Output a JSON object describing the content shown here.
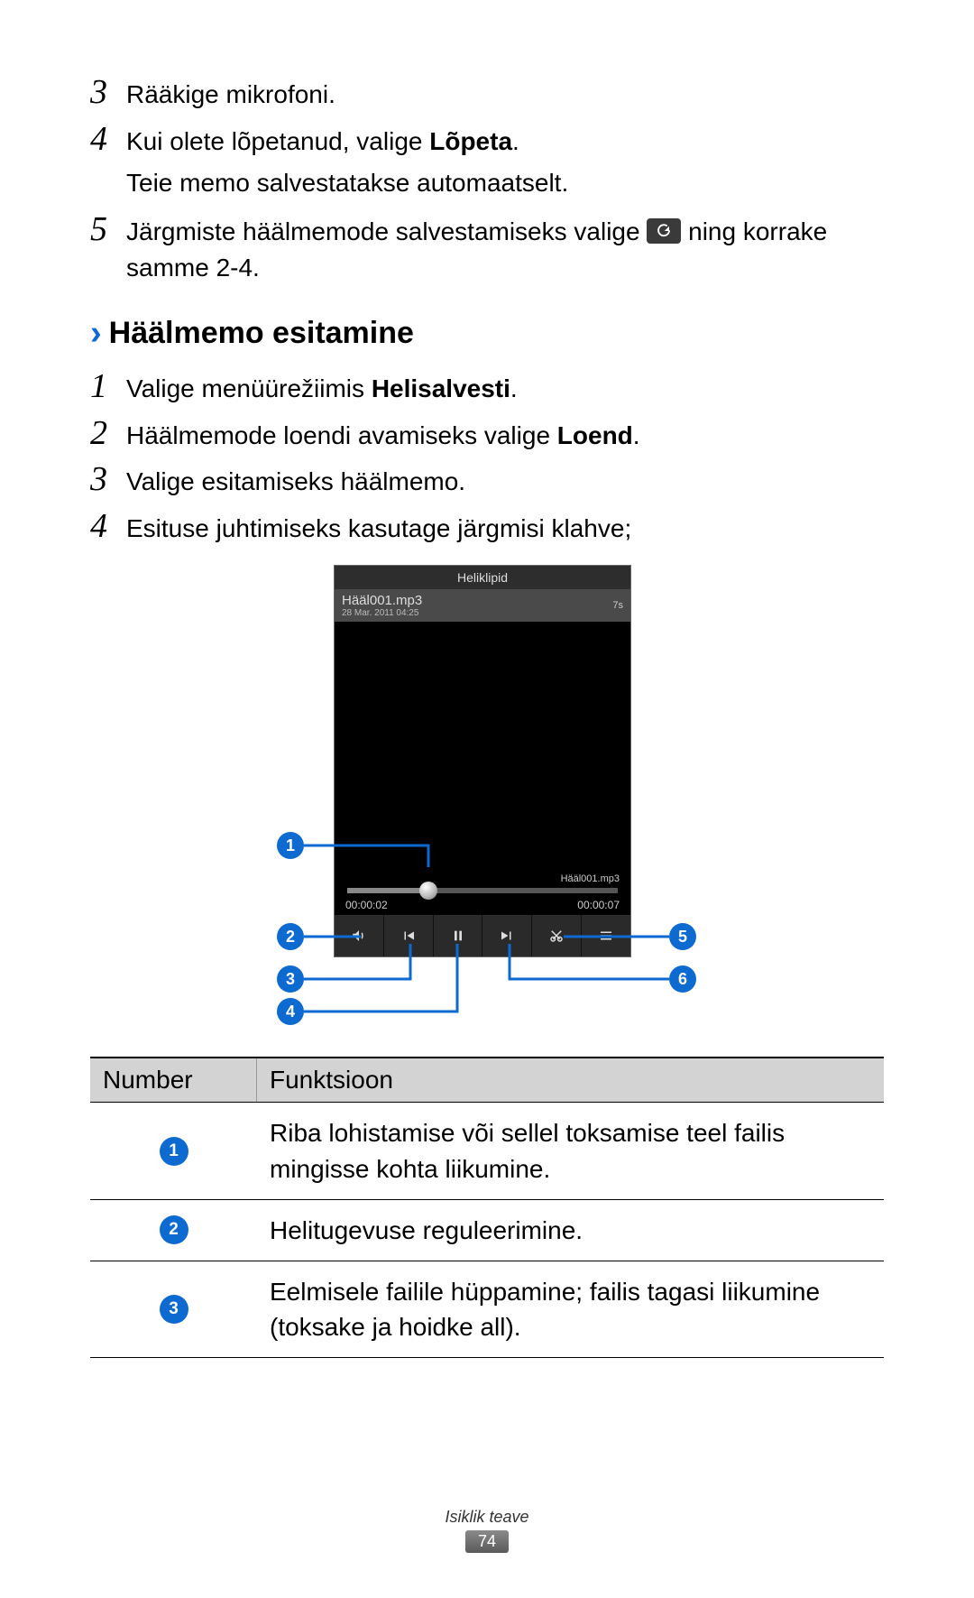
{
  "steps_top": [
    {
      "num": "3",
      "parts": [
        {
          "t": "Rääkige mikrofoni."
        }
      ]
    },
    {
      "num": "4",
      "parts": [
        {
          "t": "Kui olete lõpetanud, valige "
        },
        {
          "t": "Lõpeta",
          "bold": true
        },
        {
          "t": "."
        }
      ],
      "continuation": "Teie memo salvestatakse automaatselt."
    },
    {
      "num": "5",
      "parts": [
        {
          "t": "Järgmiste häälmemode salvestamiseks valige "
        },
        {
          "icon": "record"
        },
        {
          "t": " ning korrake samme 2-4."
        }
      ]
    }
  ],
  "section_heading": "Häälmemo esitamine",
  "steps_play": [
    {
      "num": "1",
      "parts": [
        {
          "t": "Valige menüürežiimis "
        },
        {
          "t": "Helisalvesti",
          "bold": true
        },
        {
          "t": "."
        }
      ]
    },
    {
      "num": "2",
      "parts": [
        {
          "t": "Häälmemode loendi avamiseks valige "
        },
        {
          "t": "Loend",
          "bold": true
        },
        {
          "t": "."
        }
      ]
    },
    {
      "num": "3",
      "parts": [
        {
          "t": "Valige esitamiseks häälmemo."
        }
      ]
    },
    {
      "num": "4",
      "parts": [
        {
          "t": "Esituse juhtimiseks kasutage järgmisi klahve;"
        }
      ]
    }
  ],
  "phone": {
    "title": "Heliklipid",
    "file_name": "Hääl001.mp3",
    "file_date": "28 Mar. 2011 04:25",
    "file_dur": "7s",
    "now_playing": "Hääl001.mp3",
    "t_elapsed": "00:00:02",
    "t_total": "00:00:07",
    "controls": [
      "volume",
      "prev",
      "pause",
      "next",
      "trim",
      "menu"
    ]
  },
  "callouts": [
    "1",
    "2",
    "3",
    "4",
    "5",
    "6"
  ],
  "table": {
    "headers": {
      "num": "Number",
      "func": "Funktsioon"
    },
    "rows": [
      {
        "n": "1",
        "f": "Riba lohistamise või sellel toksamise teel failis mingisse kohta liikumine."
      },
      {
        "n": "2",
        "f": "Helitugevuse reguleerimine."
      },
      {
        "n": "3",
        "f": "Eelmisele failile hüppamine; failis tagasi liikumine (toksake ja hoidke all)."
      }
    ]
  },
  "footer": {
    "section": "Isiklik teave",
    "page": "74"
  }
}
